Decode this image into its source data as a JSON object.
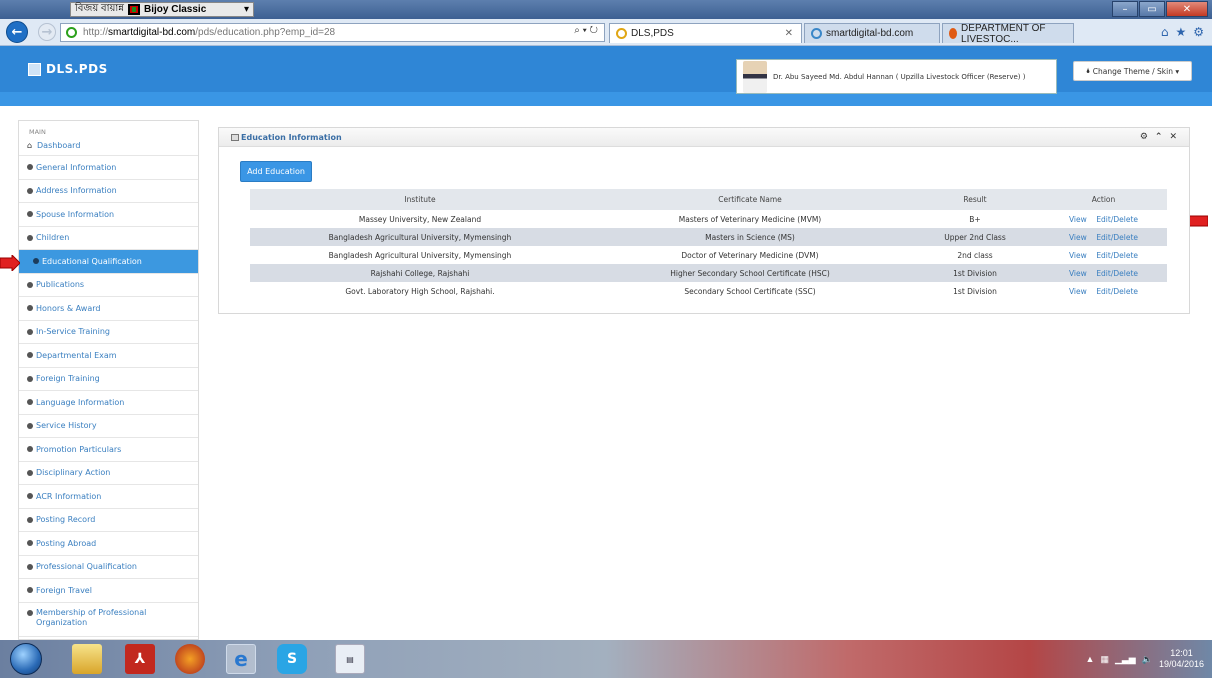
{
  "ime": {
    "lang": "বিজয় বায়ান্ন",
    "name": "Bijoy Classic"
  },
  "browser": {
    "url_prefix": "http://",
    "url_domain": "smartdigital-bd.com",
    "url_path": "/pds/education.php?emp_id=28",
    "tabs": [
      {
        "label": "DLS,PDS"
      },
      {
        "label": "smartdigital-bd.com"
      },
      {
        "label": "DEPARTMENT OF LIVESTOC..."
      }
    ]
  },
  "header": {
    "brand": "DLS.PDS",
    "user": "Dr. Abu Sayeed Md. Abdul Hannan ( Upzilla Livestock Officer (Reserve) )",
    "theme_button": "Change Theme / Skin"
  },
  "sidebar": {
    "heading": "MAIN",
    "items": [
      "Dashboard",
      "General Information",
      "Address Information",
      "Spouse Information",
      "Children",
      "Educational Qualification",
      "Publications",
      "Honors & Award",
      "In-Service Training",
      "Departmental Exam",
      "Foreign Training",
      "Language Information",
      "Service History",
      "Promotion Particulars",
      "Disciplinary Action",
      "ACR Information",
      "Posting Record",
      "Posting Abroad",
      "Professional Qualification",
      "Foreign Travel",
      "Membership of Professional Organization"
    ]
  },
  "panel": {
    "title": "Education Information",
    "add_button": "Add Education",
    "columns": [
      "Institute",
      "Certificate Name",
      "Result",
      "Action"
    ],
    "rows": [
      [
        "Massey University, New Zealand",
        "Masters of Veterinary Medicine (MVM)",
        "B+"
      ],
      [
        "Bangladesh Agricultural University, Mymensingh",
        "Masters in Science (MS)",
        "Upper 2nd Class"
      ],
      [
        "Bangladesh Agricultural University, Mymensingh",
        "Doctor of Veterinary Medicine (DVM)",
        "2nd class"
      ],
      [
        "Rajshahi College, Rajshahi",
        "Higher Secondary School Certificate (HSC)",
        "1st Division"
      ],
      [
        "Govt. Laboratory High School, Rajshahi.",
        "Secondary School Certificate (SSC)",
        "1st Division"
      ]
    ],
    "actions": {
      "view": "View",
      "edit": "Edit",
      "sep": "/",
      "delete": "Delete"
    }
  },
  "taskbar": {
    "time": "12:01",
    "date": "19/04/2016"
  },
  "colors": {
    "accent": "#3a96e5",
    "arrow": "#e02020"
  },
  "icons": [
    "search-icon",
    "refresh-icon",
    "home-icon",
    "star-icon",
    "gear-icon",
    "close-icon",
    "chevron-up-icon",
    "user-avatar"
  ]
}
